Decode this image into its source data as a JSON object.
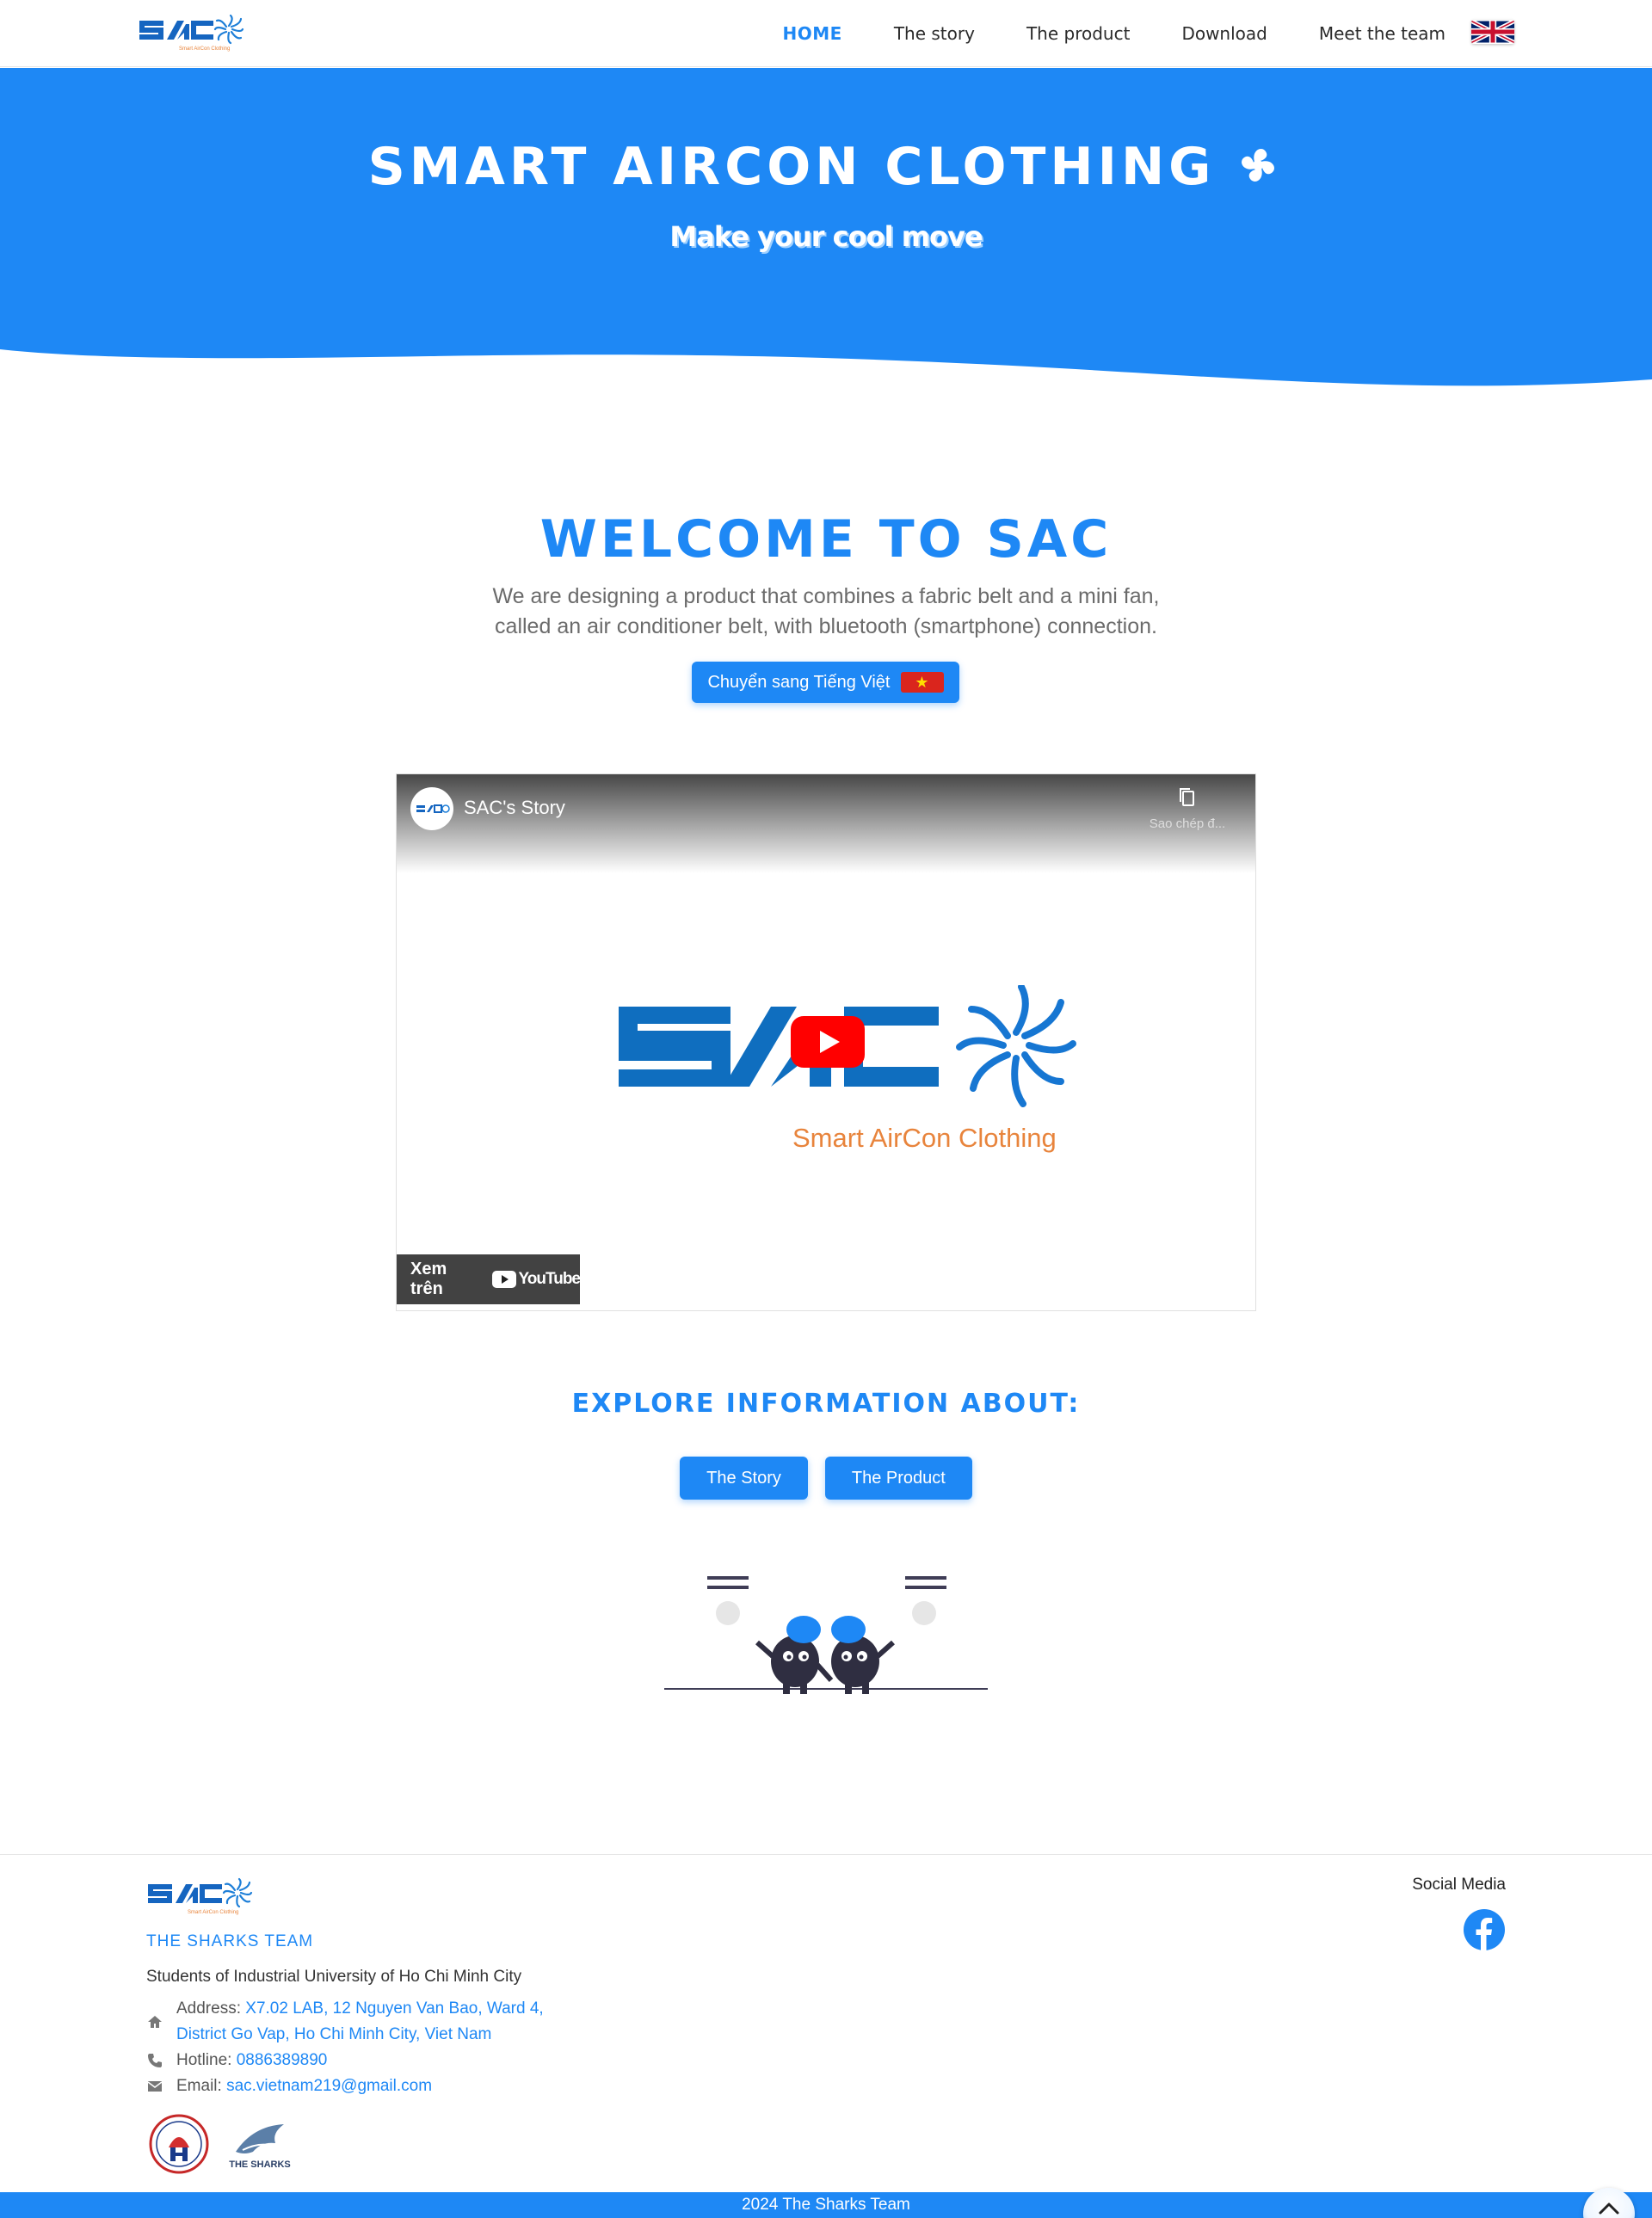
{
  "nav": {
    "logo_icon": "sac-logo",
    "logo_tagline": "Smart AirCon Clothing",
    "items": [
      {
        "label": "HOME",
        "active": true
      },
      {
        "label": "The story",
        "active": false
      },
      {
        "label": "The product",
        "active": false
      },
      {
        "label": "Download",
        "active": false
      },
      {
        "label": "Meet the team",
        "active": false
      }
    ],
    "language_flag_icon": "uk-flag-icon"
  },
  "hero": {
    "title": "SMART AIRCON CLOTHING",
    "subtitle": "Make your cool move",
    "icon": "fan-icon",
    "color": "#1e88f5"
  },
  "welcome": {
    "title": "WELCOME TO SAC",
    "desc_line1": "We are designing a product that combines a fabric belt and a mini fan,",
    "desc_line2": "called an air conditioner belt, with bluetooth (smartphone) connection.",
    "switch_language_label": "Chuyển sang Tiếng Việt",
    "switch_language_icon": "vietnam-flag-icon"
  },
  "video": {
    "title": "SAC's Story",
    "copy_label": "Sao chép đ...",
    "logo_word": "SAC",
    "logo_tagline": "Smart AirCon Clothing",
    "watch_on_label": "Xem trên",
    "platform_label": "YouTube",
    "play_icon": "play-icon",
    "copy_icon": "copy-icon",
    "accent_red": "#ff0000",
    "logo_tagline_color": "#e8843c"
  },
  "explore": {
    "title": "EXPLORE INFORMATION ABOUT:",
    "buttons": [
      "The Story",
      "The Product"
    ]
  },
  "footer": {
    "team_name": "THE SHARKS TEAM",
    "students": "Students of Industrial University of Ho Chi Minh City",
    "address_label": "Address: ",
    "address_line1": "X7.02 LAB, 12 Nguyen Van Bao, Ward 4,",
    "address_line2": "District Go Vap, Ho Chi Minh City, Viet Nam",
    "hotline_label": "Hotline: ",
    "hotline": "0886389890",
    "email_label": "Email: ",
    "email": "sac.vietnam219@gmail.com",
    "social_media_label": "Social Media",
    "social_icon": "facebook-icon",
    "sharks_logo_text": "THE SHARKS",
    "copyright": "2024 The Sharks Team",
    "scroll_top_icon": "chevron-up-icon"
  }
}
